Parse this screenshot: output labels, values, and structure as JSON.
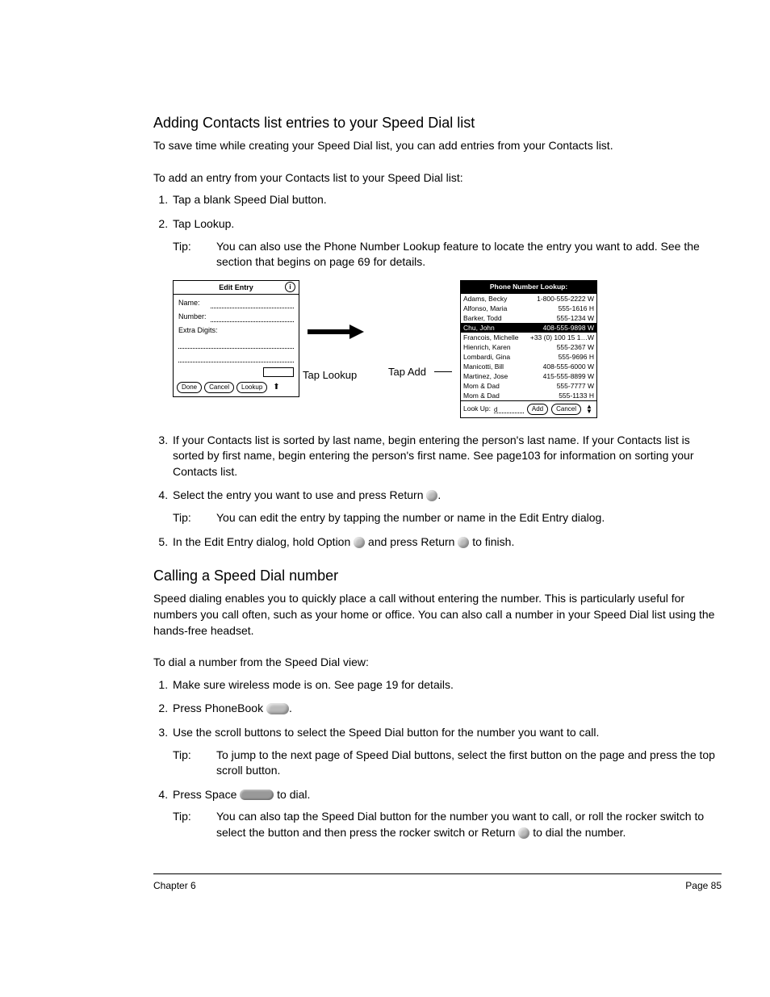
{
  "section1": {
    "heading": "Adding Contacts list entries to your Speed Dial list",
    "intro": "To save time while creating your Speed Dial list, you can add entries from your Contacts list.",
    "subhead": "To add an entry from your Contacts list to your Speed Dial list:",
    "step1": "Tap a blank Speed Dial button.",
    "step2": "Tap Lookup.",
    "tip1_label": "Tip:",
    "tip1_text": "You can also use the Phone Number Lookup feature to locate the entry you want to add. See the section that begins on page 69 for details.",
    "step3": "If your Contacts list is sorted by last name, begin entering the person's last name. If your Contacts list is sorted by first name, begin entering the person's first name. See page103 for information on sorting your Contacts list.",
    "step4a": "Select the entry you want to use and press Return ",
    "step4b": ".",
    "tip2_label": "Tip:",
    "tip2_text": "You can edit the entry by tapping the number or name in the Edit Entry dialog.",
    "step5a": "In the Edit Entry dialog, hold Option ",
    "step5b": " and press Return ",
    "step5c": " to finish."
  },
  "figure": {
    "edit_title": "Edit Entry",
    "name_label": "Name:",
    "number_label": "Number:",
    "extra_label": "Extra Digits:",
    "done": "Done",
    "cancel": "Cancel",
    "lookup": "Lookup",
    "tap_lookup": "Tap Lookup",
    "tap_add": "Tap Add",
    "lookup_title": "Phone Number Lookup:",
    "rows": [
      {
        "n": "Adams, Becky",
        "p": "1-800-555-2222 W"
      },
      {
        "n": "Alfonso, Maria",
        "p": "555-1616 H"
      },
      {
        "n": "Barker, Todd",
        "p": "555-1234 W"
      },
      {
        "n": "Chu, John",
        "p": "408-555-9898 W"
      },
      {
        "n": "Francois, Michelle",
        "p": "+33 (0) 100 15 1…W"
      },
      {
        "n": "Hienrich, Karen",
        "p": "555-2367 W"
      },
      {
        "n": "Lombardi, Gina",
        "p": "555-9696 H"
      },
      {
        "n": "Manicotti, Bill",
        "p": "408-555-6000 W"
      },
      {
        "n": "Martinez, Jose",
        "p": "415-555-8899 W"
      },
      {
        "n": "Mom & Dad",
        "p": "555-7777 W"
      },
      {
        "n": "Mom & Dad",
        "p": "555-1133 H"
      }
    ],
    "lookup_label": "Look Up:",
    "lookup_value": "d",
    "add": "Add"
  },
  "section2": {
    "heading": "Calling a Speed Dial number",
    "intro": "Speed dialing enables you to quickly place a call without entering the number. This is particularly useful for numbers you call often, such as your home or office. You can also call a number in your Speed Dial list using the hands-free headset.",
    "subhead": "To dial a number from the Speed Dial view:",
    "step1": "Make sure wireless mode is on. See page 19 for details.",
    "step2a": "Press PhoneBook ",
    "step2b": ".",
    "step3": "Use the scroll buttons to select the Speed Dial button for the number you want to call.",
    "tip1_label": "Tip:",
    "tip1_text": "To jump to the next page of Speed Dial buttons, select the first button on the page and press the top scroll button.",
    "step4a": "Press Space ",
    "step4b": " to dial.",
    "tip2_label": "Tip:",
    "tip2_text_a": "You can also tap the Speed Dial button for the number you want to call, or roll the rocker switch to select the button and then press the rocker switch or Return ",
    "tip2_text_b": " to dial the number."
  },
  "footer": {
    "left": "Chapter 6",
    "right": "Page 85"
  }
}
